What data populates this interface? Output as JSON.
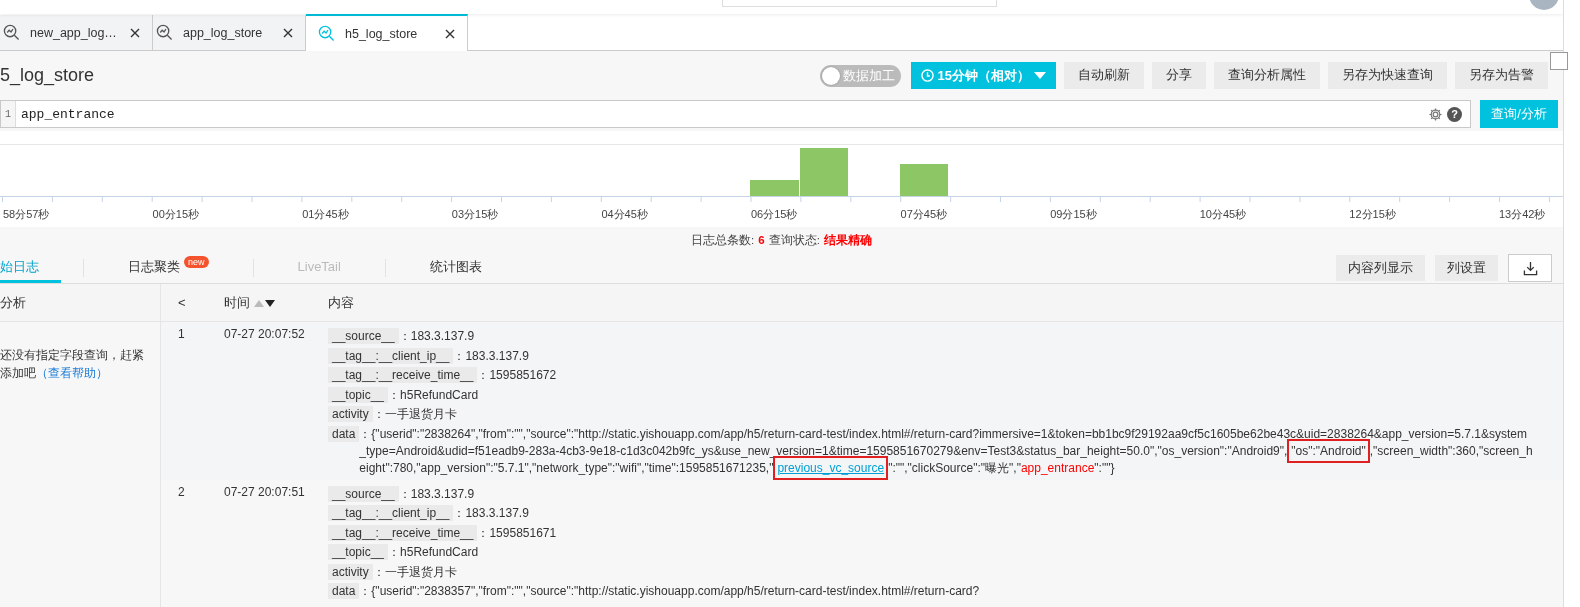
{
  "tabs": [
    {
      "label": "new_app_log…",
      "selected": false
    },
    {
      "label": "app_log_store",
      "selected": false
    },
    {
      "label": "h5_log_store",
      "selected": true
    }
  ],
  "logstore": {
    "title": "5_log_store",
    "toggle": {
      "label": "数据加工",
      "on": false
    },
    "time_range": "15分钟（相对）",
    "buttons": [
      "自动刷新",
      "分享",
      "查询分析属性",
      "另存为快速查询",
      "另存为告警"
    ]
  },
  "corner_checkbox": {
    "checked": false
  },
  "query": {
    "line_number": "1",
    "value": "app_entrance",
    "help": "?",
    "submit": "查询/分析"
  },
  "histogram": {
    "labels": [
      "58分57秒",
      "00分15秒",
      "01分45秒",
      "03分15秒",
      "04分45秒",
      "06分15秒",
      "07分45秒",
      "09分15秒",
      "10分45秒",
      "12分15秒",
      "13分42秒"
    ]
  },
  "summary": {
    "count_label": "日志总条数:",
    "count": "6",
    "status_label": "查询状态:",
    "status": "结果精确"
  },
  "view_tabs": [
    {
      "label": "始日志",
      "selected": true,
      "disabled": false
    },
    {
      "label": "日志聚类",
      "selected": false,
      "disabled": false,
      "badge": "new"
    },
    {
      "label": "LiveTail",
      "selected": false,
      "disabled": true
    },
    {
      "label": "统计图表",
      "selected": false,
      "disabled": false
    }
  ],
  "view_buttons": [
    "内容列显示",
    "列设置"
  ],
  "sidebar": {
    "header": "分析",
    "message": "还没有指定字段查询，赶紧添加吧",
    "help_link": "（查看帮助）"
  },
  "table": {
    "collapse": "<",
    "columns": [
      "时间",
      "内容"
    ],
    "rows": [
      {
        "index": "1",
        "time": "07-27 20:07:52",
        "fields": [
          {
            "key": "__source__",
            "value": "：183.3.137.9"
          },
          {
            "key": "__tag__:__client_ip__",
            "value": "：183.3.137.9"
          },
          {
            "key": "__tag__:__receive_time__",
            "value": "：1595851672"
          },
          {
            "key": "__topic__",
            "value": "：h5RefundCard"
          },
          {
            "key": "activity",
            "value": "：一手退货月卡"
          },
          {
            "key": "data",
            "segments": [
              {
                "kind": "text",
                "text": "：{\"userid\":\"2838264\",\"from\":\"\",\"source\":\"http://static.yishouapp.com/app/h5/return-card-test/index.html#/return-card?immersive=1&token=bb1bc9f29192aa9cf5c1605be62be43c&uid=2838264&app_version=5.7.1&system_type=Android&udid=f51eadb9-283a-4cb3-9e18-c1d3c042b9fc_ys&use_new_version=1&time=1595851670279&env=Test3&status_bar_height=50.0\",\"os_version\":\"Android9\","
              },
              {
                "kind": "annotated",
                "text": "\"os\":\"Android\""
              },
              {
                "kind": "text",
                "text": ",\"screen_width\":360,\"screen_height\":780,\"app_version\":\"5.7.1\",\"network_type\":\"wifi\",\"time\":1595851671235,\""
              },
              {
                "kind": "annotated_link",
                "text": "previous_vc_source"
              },
              {
                "kind": "text",
                "text": "\":\"\",\"clickSource\":\"曝光\",\""
              },
              {
                "kind": "keyword",
                "text": "app_entrance"
              },
              {
                "kind": "text",
                "text": "\":\"\"}"
              }
            ]
          }
        ]
      },
      {
        "index": "2",
        "time": "07-27 20:07:51",
        "fields": [
          {
            "key": "__source__",
            "value": "：183.3.137.9"
          },
          {
            "key": "__tag__:__client_ip__",
            "value": "：183.3.137.9"
          },
          {
            "key": "__tag__:__receive_time__",
            "value": "：1595851671"
          },
          {
            "key": "__topic__",
            "value": "：h5RefundCard"
          },
          {
            "key": "activity",
            "value": "：一手退货月卡"
          },
          {
            "key": "data",
            "segments": [
              {
                "kind": "text",
                "text": "：{\"userid\":\"2838357\",\"from\":\"\",\"source\":\"http://static.yishouapp.com/app/h5/return-card-test/index.html#/return-card?"
              }
            ]
          }
        ]
      }
    ]
  }
}
